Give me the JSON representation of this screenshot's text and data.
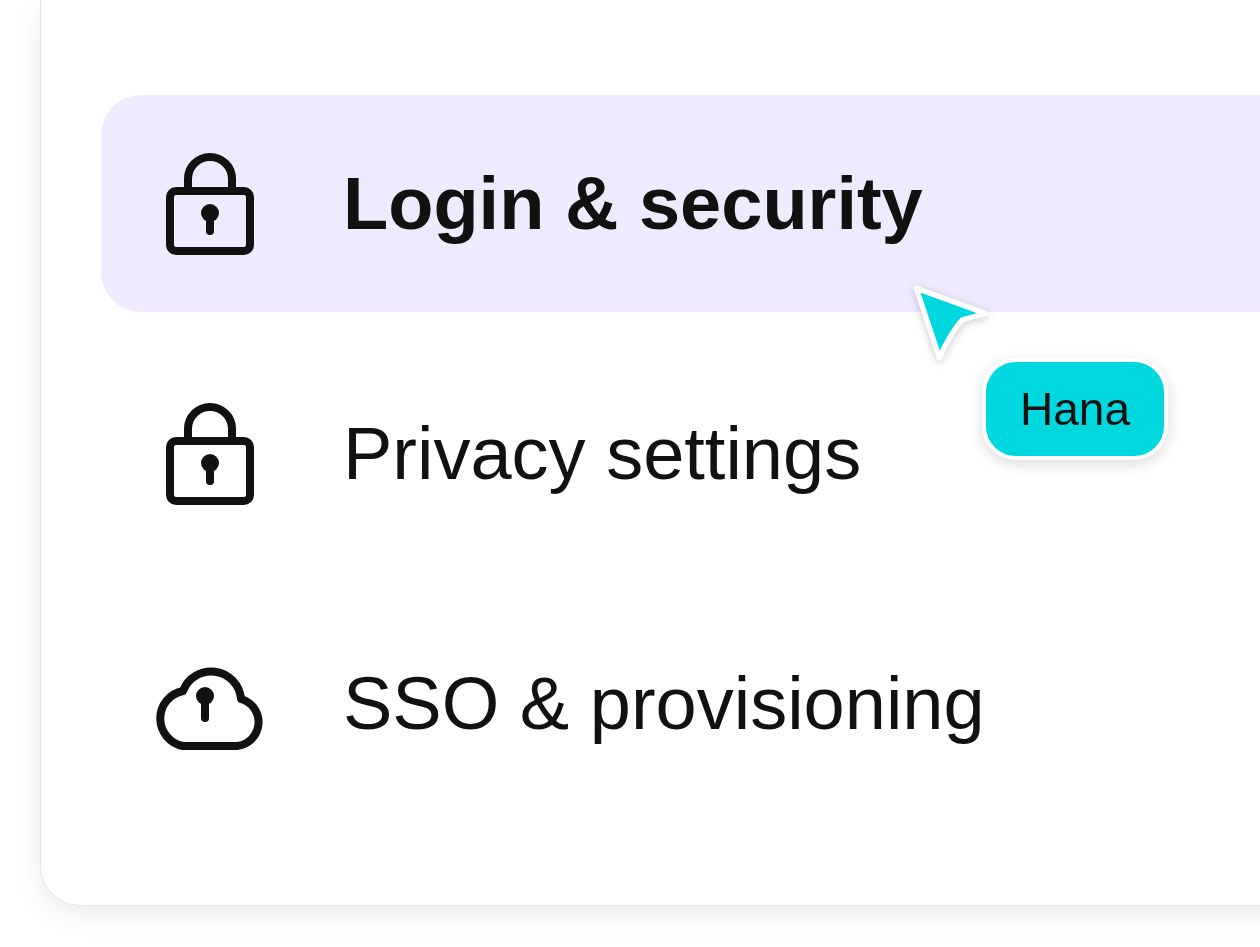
{
  "menu": {
    "items": [
      {
        "label": "Login & security",
        "kind": "lock",
        "selected": true
      },
      {
        "label": "Privacy settings",
        "kind": "lock",
        "selected": false
      },
      {
        "label": "SSO & provisioning",
        "kind": "cloud",
        "selected": false
      }
    ]
  },
  "cursor": {
    "name": "Hana",
    "color": "#00d8e0"
  }
}
